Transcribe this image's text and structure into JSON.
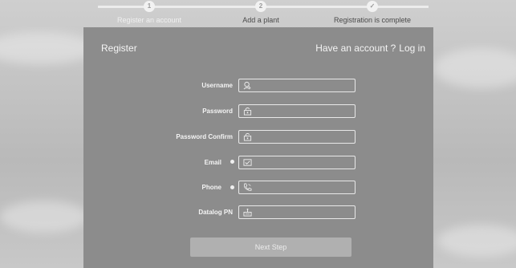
{
  "steps": [
    {
      "number": "1",
      "label": "Register an account",
      "active": true
    },
    {
      "number": "2",
      "label": "Add a plant",
      "active": false
    },
    {
      "number": "✓",
      "label": "Registration is complete",
      "active": false
    }
  ],
  "panel": {
    "title": "Register",
    "have_account_text": "Have an account ?",
    "login_label": "Log in"
  },
  "form": {
    "username_label": "Username",
    "password_label": "Password",
    "password_confirm_label": "Password Confirm",
    "email_label": "Email",
    "phone_label": "Phone",
    "datalog_label": "Datalog PN",
    "username_value": "",
    "password_value": "",
    "password_confirm_value": "",
    "email_value": "",
    "phone_value": "",
    "datalog_value": ""
  },
  "next_step_label": "Next Step",
  "icons": {
    "username": "user-icon",
    "password": "lock-icon",
    "password_confirm": "lock-icon",
    "email": "email-icon",
    "phone": "phone-icon",
    "datalog": "datalogger-icon"
  },
  "colors": {
    "panel_bg": "#8c8c8c",
    "button_bg": "#b0b0b0",
    "text_light": "#f4f4f4"
  }
}
